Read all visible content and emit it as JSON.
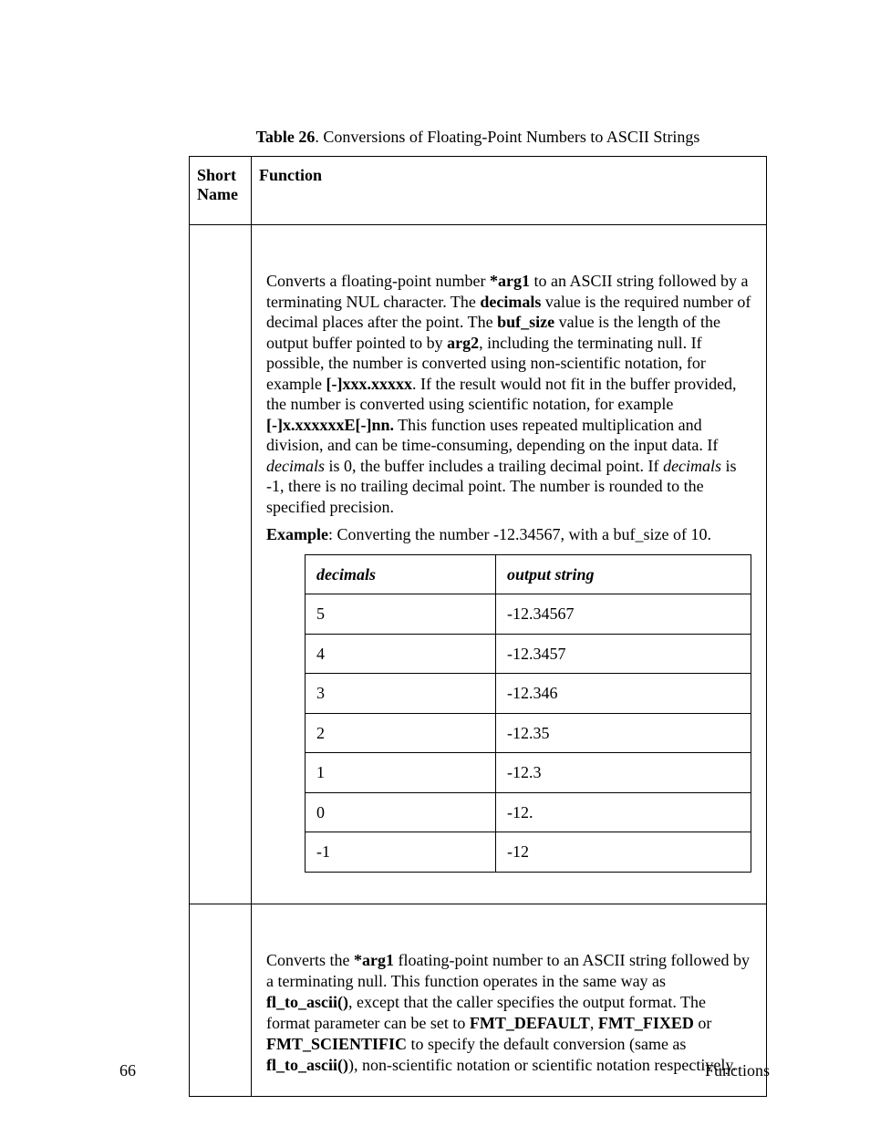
{
  "caption": {
    "label": "Table 26",
    "rest": ". Conversions of Floating-Point Numbers to ASCII Strings"
  },
  "headers": {
    "short_name": "Short Name",
    "function": "Function"
  },
  "row1": {
    "p1a": "Converts a floating-point number ",
    "p1b": "*arg1",
    "p1c": " to an ASCII string followed by a terminating NUL character.  The ",
    "p1d": "decimals",
    "p1e": " value is the required number of decimal places after the point.  The ",
    "p1f": "buf_size",
    "p1g": " value is the length of the output buffer pointed to by ",
    "p1h": "arg2",
    "p1i": ", including the terminating null.  If possible, the number is converted using non-scientific notation, for example ",
    "p1j": "[-]xxx.xxxxx",
    "p1k": ".  If the result would not fit in the buffer provided, the number is converted using scientific notation, for example ",
    "p1l": "[-]x.xxxxxxE[-]nn.",
    "p1m": "  This function uses repeated multiplication and division, and can be time-consuming, depending on the input data.  If ",
    "p1n": "decimals",
    "p1o": " is 0, the buffer includes a trailing decimal point.  If ",
    "p1p": "decimals",
    "p1q": " is -1, there is no trailing decimal point.  The number is rounded to the specified precision.",
    "ex_label": "Example",
    "ex_rest": ":  Converting the number -12.34567, with a buf_size of 10.",
    "inner_h1": "decimals",
    "inner_h2": "output string",
    "rows": [
      {
        "d": "5",
        "o": "-12.34567"
      },
      {
        "d": "4",
        "o": "-12.3457"
      },
      {
        "d": "3",
        "o": "-12.346"
      },
      {
        "d": "2",
        "o": "-12.35"
      },
      {
        "d": "1",
        "o": "-12.3"
      },
      {
        "d": "0",
        "o": "-12."
      },
      {
        "d": "-1",
        "o": "-12"
      }
    ]
  },
  "row2": {
    "a": "Converts the ",
    "b": "*arg1",
    "c": " floating-point number to an ASCII string followed by a terminating null.   This function operates in the same way as ",
    "d": "fl_to_ascii()",
    "e": ", except that the caller specifies the output format.  The format parameter can be set to ",
    "f": "FMT_DEFAULT",
    "g": ", ",
    "h": "FMT_FIXED",
    "i": " or ",
    "j": "FMT_SCIENTIFIC",
    "k": " to specify the default conversion (same as ",
    "l": "fl_to_ascii()",
    "m": "), non-scientific notation or scientific notation respectively."
  },
  "footer": {
    "page": "66",
    "section": "Functions"
  }
}
